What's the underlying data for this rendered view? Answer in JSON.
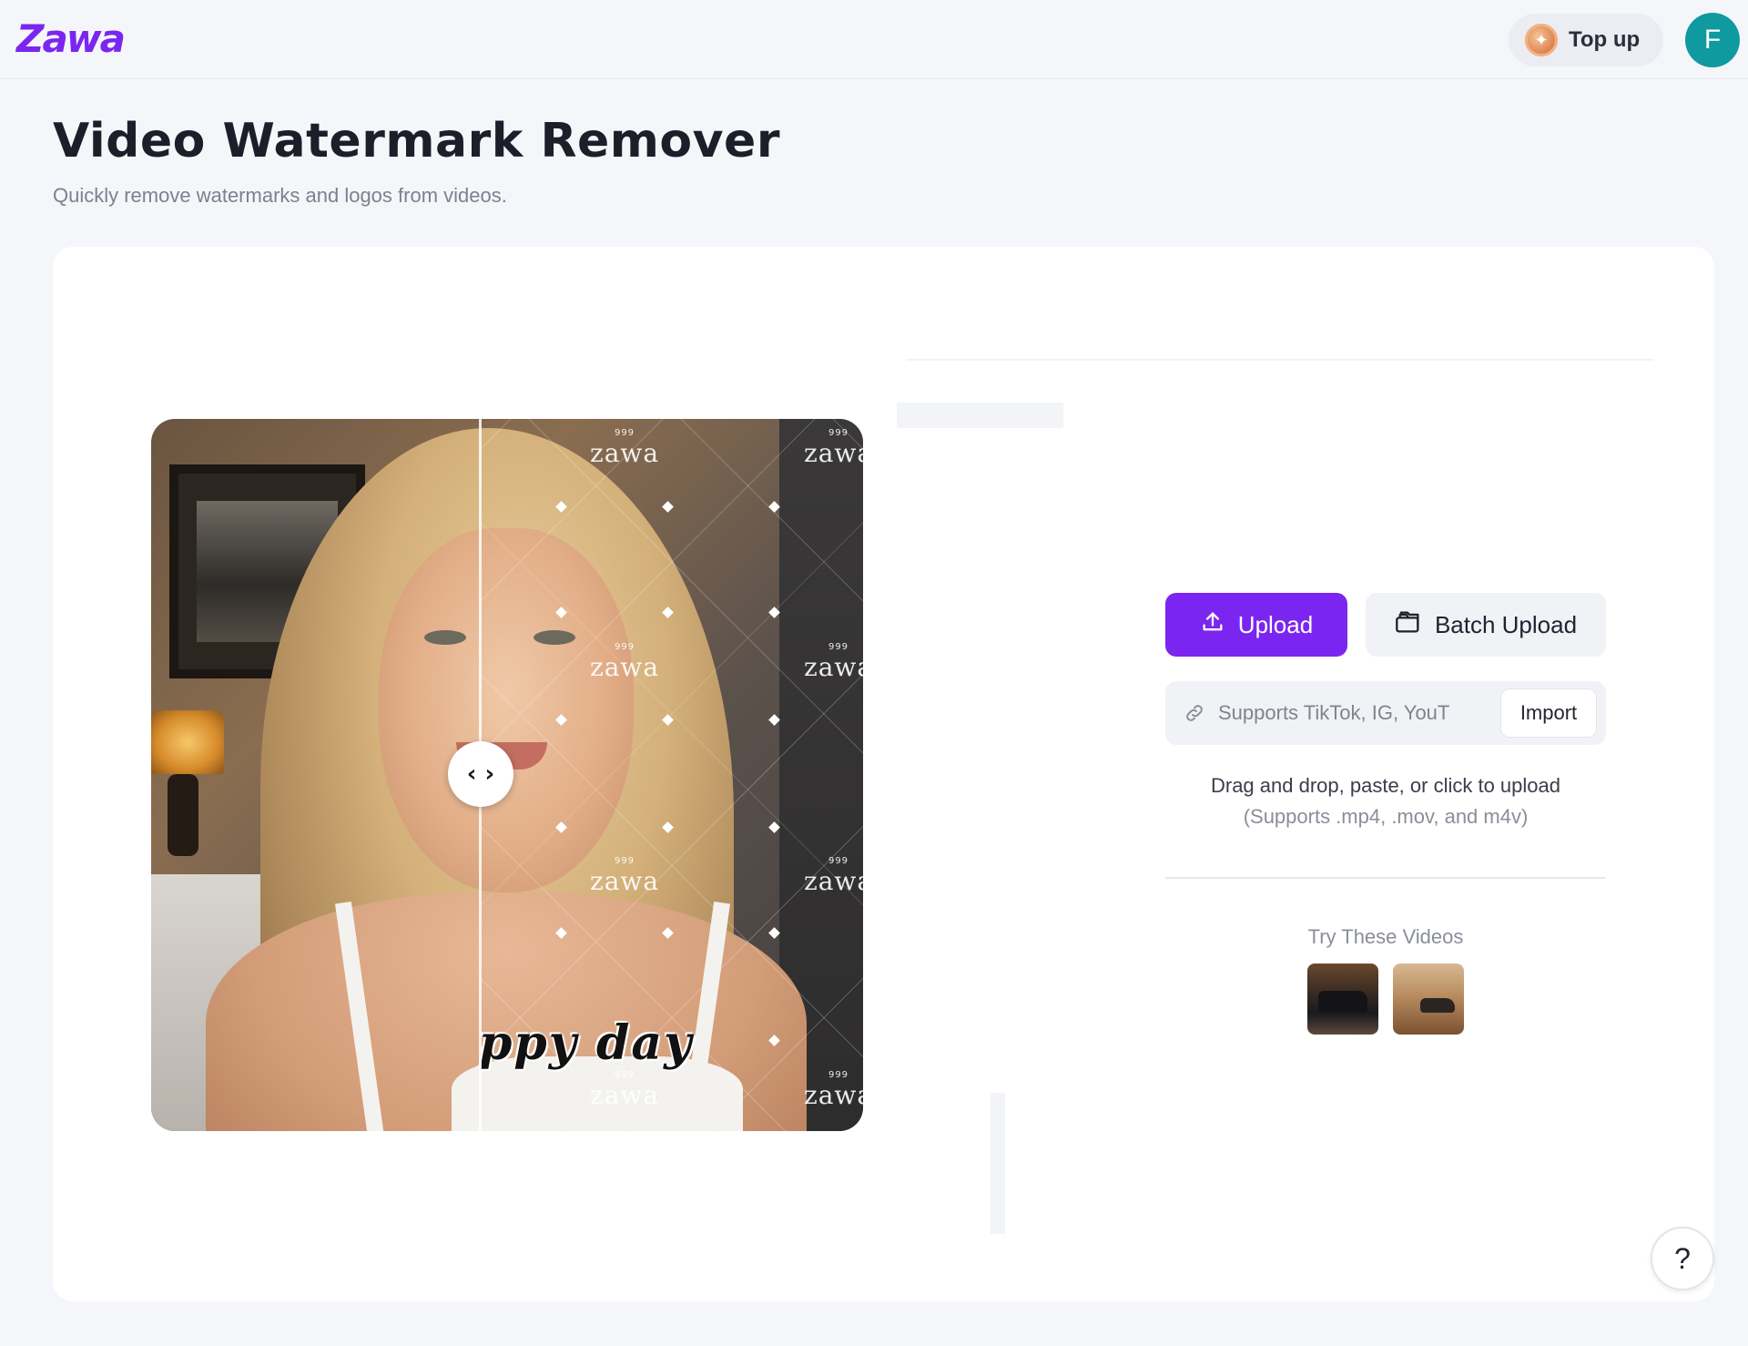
{
  "app": {
    "logo_text": "Zawa",
    "brand_color": "#7b26f0"
  },
  "topbar": {
    "topup_label": "Top up",
    "topup_icon": "coin-icon",
    "avatar_letter": "F",
    "avatar_color": "#0e9a9f"
  },
  "header": {
    "title": "Video Watermark Remover",
    "subtitle": "Quickly remove watermarks and logos from videos."
  },
  "preview": {
    "caption_text": "ppy  day",
    "watermark_text": "zawa",
    "watermark_badge": "999",
    "slider_handle": "‹ ›"
  },
  "upload_panel": {
    "upload_label": "Upload",
    "upload_icon": "upload-icon",
    "batch_upload_label": "Batch Upload",
    "batch_icon": "folder-icon",
    "url_placeholder": "Supports TikTok, IG, YouT",
    "url_icon": "link-icon",
    "import_label": "Import",
    "drop_hint": "Drag and drop, paste, or click to upload",
    "drop_formats": "(Supports .mp4, .mov, and m4v)",
    "try_title": "Try These Videos",
    "sample_videos": [
      "sample-video-1",
      "sample-video-2"
    ]
  },
  "help": {
    "label": "?"
  }
}
